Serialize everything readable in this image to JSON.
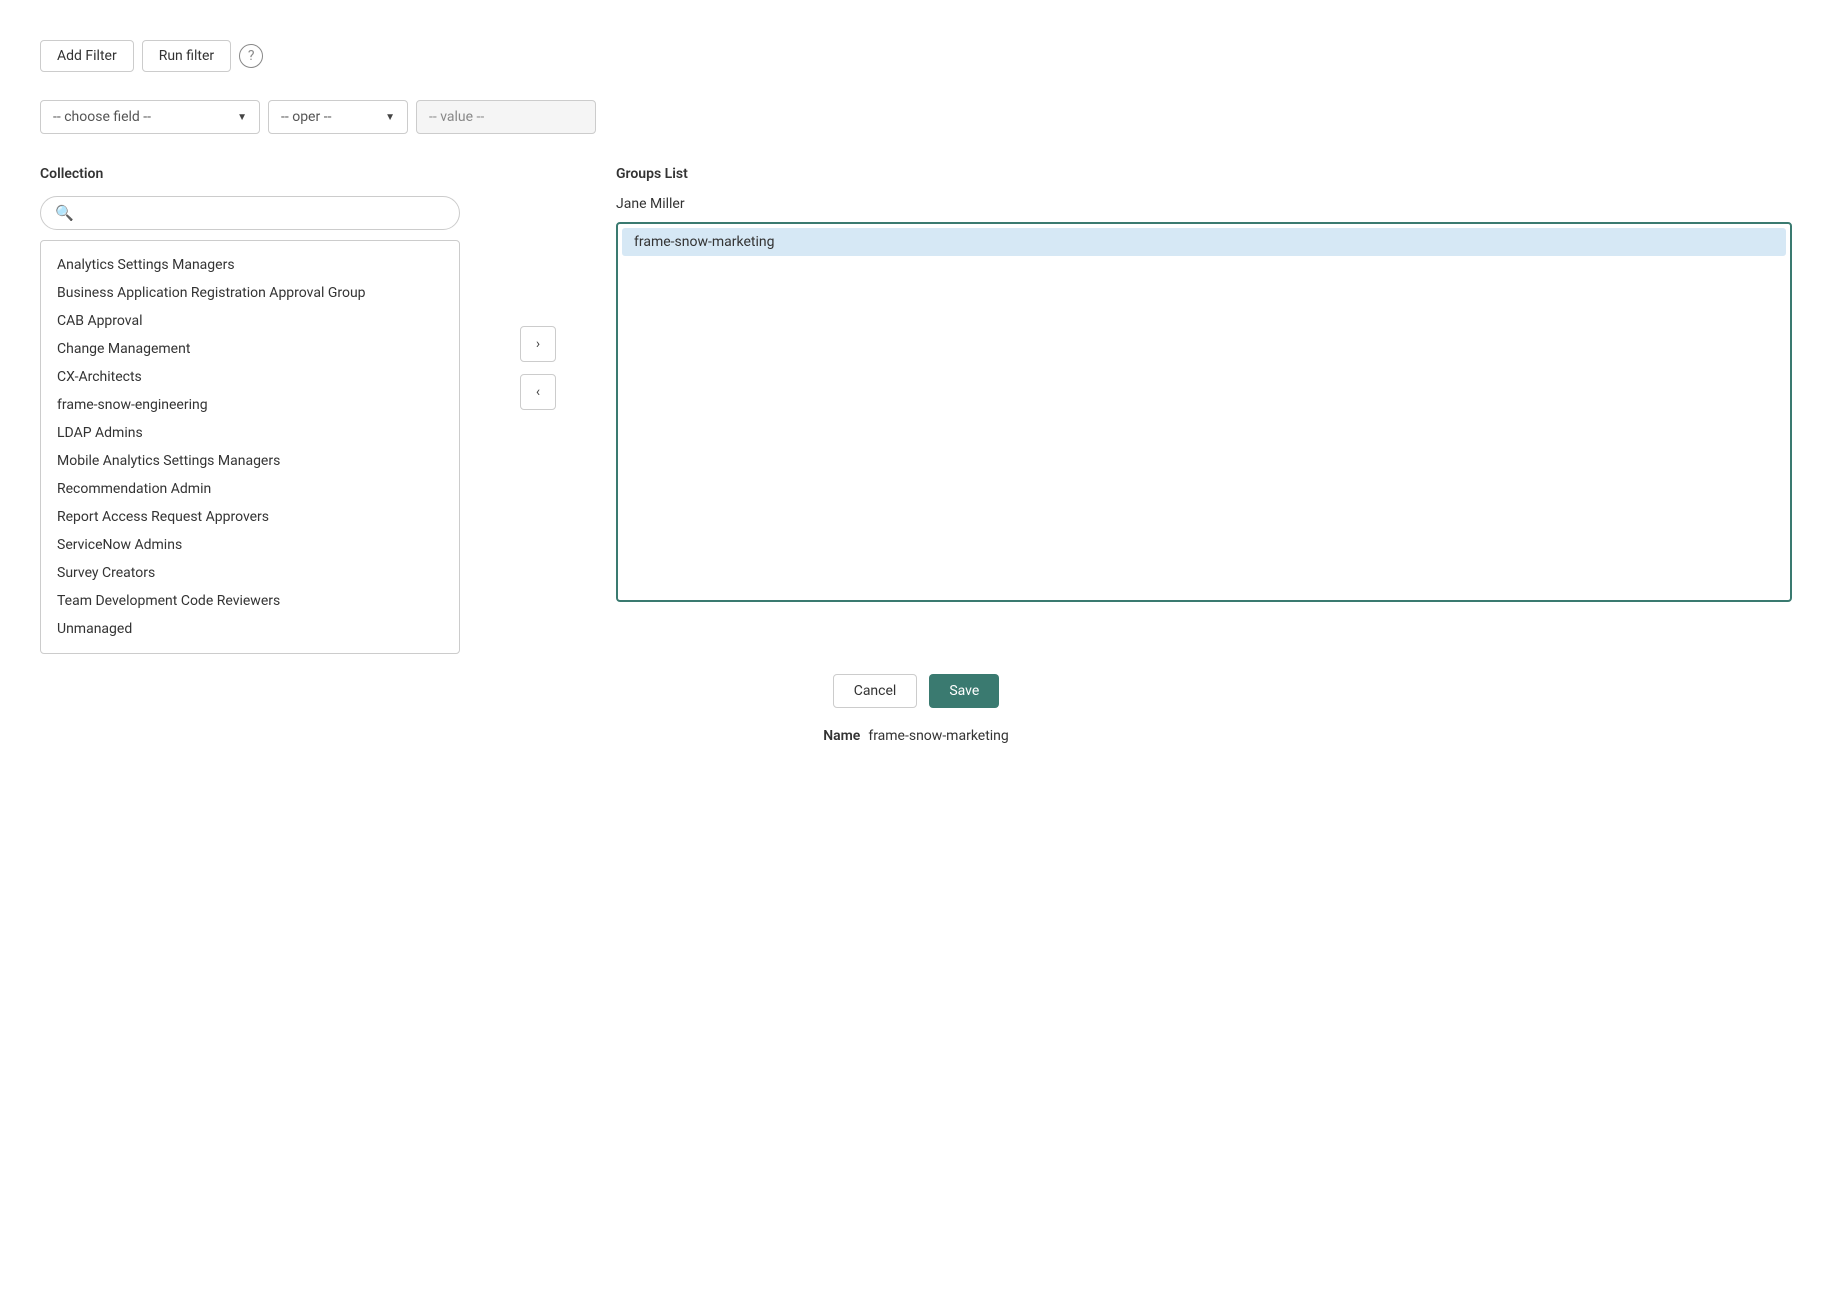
{
  "toolbar": {
    "add_filter_label": "Add Filter",
    "run_filter_label": "Run filter",
    "help_icon_char": "?"
  },
  "filter": {
    "field_placeholder": "-- choose field --",
    "oper_placeholder": "-- oper --",
    "value_placeholder": "-- value --"
  },
  "collection": {
    "title": "Collection",
    "search_placeholder": "",
    "items": [
      "Analytics Settings Managers",
      "Business Application Registration Approval Group",
      "CAB Approval",
      "Change Management",
      "CX-Architects",
      "frame-snow-engineering",
      "LDAP Admins",
      "Mobile Analytics Settings Managers",
      "Recommendation Admin",
      "Report Access Request Approvers",
      "ServiceNow Admins",
      "Survey Creators",
      "Team Development Code Reviewers",
      "Unmanaged"
    ]
  },
  "groups": {
    "title": "Groups List",
    "user": "Jane Miller",
    "items": [
      "frame-snow-marketing"
    ],
    "selected_index": 0
  },
  "actions": {
    "cancel_label": "Cancel",
    "save_label": "Save",
    "forward_arrow": "›",
    "back_arrow": "‹"
  },
  "name_row": {
    "label": "Name",
    "value": "frame-snow-marketing"
  }
}
